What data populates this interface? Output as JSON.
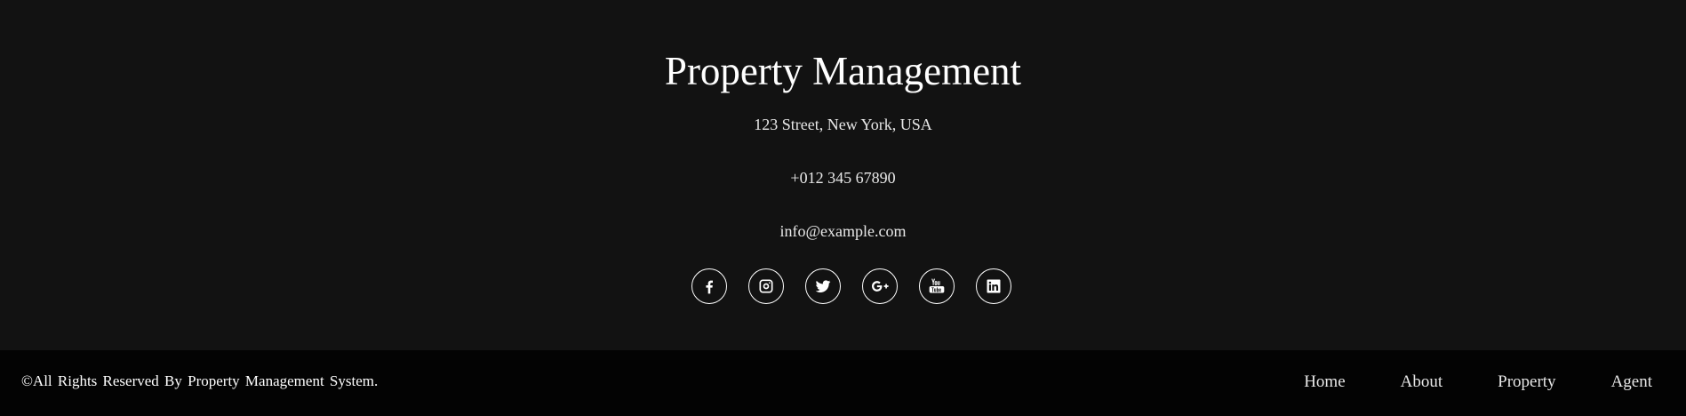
{
  "footer": {
    "brand": "Property Management",
    "address": "123 Street, New York, USA",
    "phone": "+012 345 67890",
    "email": "info@example.com",
    "social": [
      {
        "icon": "facebook-icon"
      },
      {
        "icon": "instagram-icon"
      },
      {
        "icon": "twitter-icon"
      },
      {
        "icon": "google-plus-icon"
      },
      {
        "icon": "youtube-icon"
      },
      {
        "icon": "linkedin-icon"
      }
    ]
  },
  "bottom_bar": {
    "copyright": "©All Rights Reserved By Property Management System.",
    "nav": [
      "Home",
      "About",
      "Property",
      "Agent"
    ]
  },
  "colors": {
    "footer_bg": "#121212",
    "bottom_bar_bg": "#030303",
    "text": "#ffffff"
  }
}
